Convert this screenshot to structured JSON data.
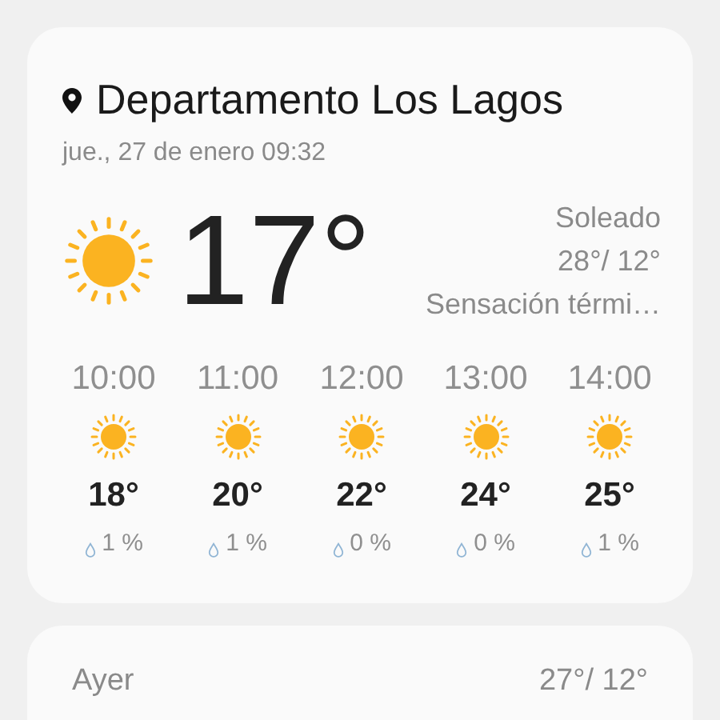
{
  "location": {
    "name": "Departamento Los Lagos",
    "datetime": "jue., 27 de enero 09:32"
  },
  "current": {
    "kind": "sunny",
    "temperature": "17°",
    "condition": "Soleado",
    "high_low": "28°/ 12°",
    "feels_like": "Sensación térmi…"
  },
  "hourly": [
    {
      "time": "10:00",
      "kind": "sunny",
      "temperature": "18°",
      "precipitation": "1 %"
    },
    {
      "time": "11:00",
      "kind": "sunny",
      "temperature": "20°",
      "precipitation": "1 %"
    },
    {
      "time": "12:00",
      "kind": "sunny",
      "temperature": "22°",
      "precipitation": "0 %"
    },
    {
      "time": "13:00",
      "kind": "sunny",
      "temperature": "24°",
      "precipitation": "0 %"
    },
    {
      "time": "14:00",
      "kind": "sunny",
      "temperature": "25°",
      "precipitation": "1 %"
    }
  ],
  "history": [
    {
      "label": "Ayer",
      "high_low": "27°/ 12°"
    }
  ]
}
